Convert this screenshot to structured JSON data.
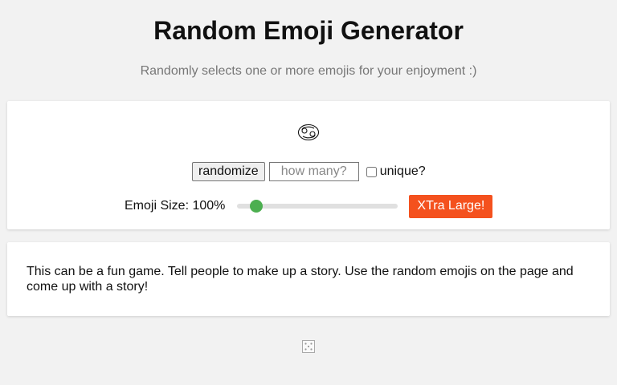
{
  "header": {
    "title": "Random Emoji Generator",
    "subtitle": "Randomly selects one or more emojis for your enjoyment :)"
  },
  "generator": {
    "emoji_icon": "cancer-zodiac-icon",
    "emoji": "♋",
    "randomize_label": "randomize",
    "count_value": "",
    "count_placeholder": "how many?",
    "unique_checked": false,
    "unique_label": "unique?",
    "size_label": "Emoji Size: 100%",
    "size_fraction": 0.085,
    "slider_color": "#4caf50",
    "xl_label": "XTra Large!",
    "xl_color": "#f4511e"
  },
  "info": {
    "text": "This can be a fun game. Tell people to make up a story. Use the random emojis on the page and come up with a story!"
  },
  "footer": {
    "icon": "dice-icon"
  }
}
